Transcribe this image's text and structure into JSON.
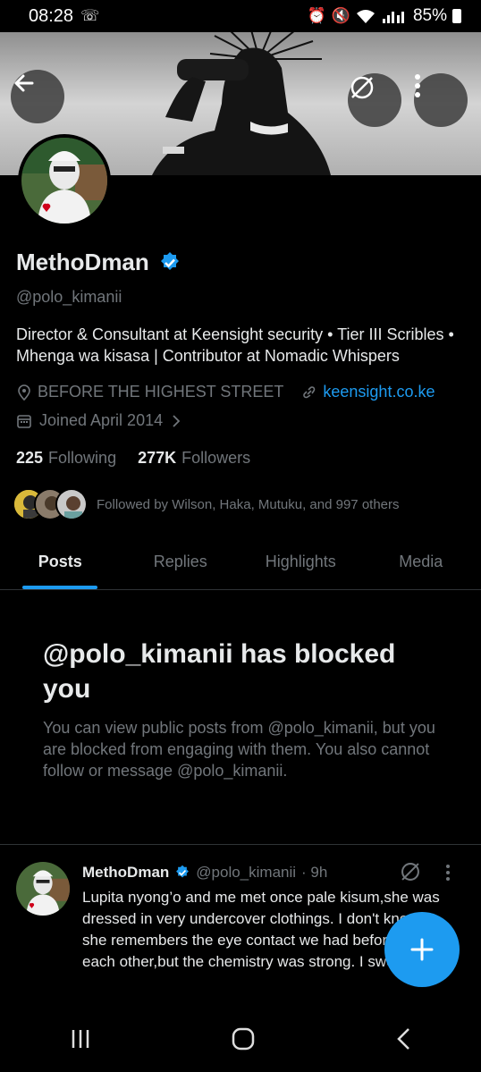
{
  "status_bar": {
    "time": "08:28",
    "battery": "85%"
  },
  "profile": {
    "display_name": "MethoDman",
    "handle": "@polo_kimanii",
    "bio_line1": "Director & Consultant at Keensight security • Tier III Scribles •",
    "bio_line2": "Mhenga wa kisasa | Contributor at Nomadic Whispers",
    "location": "BEFORE THE HIGHEST STREET",
    "website": "keensight.co.ke",
    "joined": "Joined April 2014",
    "following_count": "225",
    "following_label": "Following",
    "followers_count": "277K",
    "followers_label": "Followers",
    "followed_by": "Followed by Wilson, Haka, Mutuku, and 997 others"
  },
  "tabs": [
    {
      "label": "Posts"
    },
    {
      "label": "Replies"
    },
    {
      "label": "Highlights"
    },
    {
      "label": "Media"
    }
  ],
  "blocked_notice": {
    "title": "@polo_kimanii has blocked you",
    "description": "You can view public posts from @polo_kimanii, but you are blocked from engaging with them. You also cannot follow or message @polo_kimanii."
  },
  "post": {
    "author_name": "MethoDman",
    "author_handle": "@polo_kimanii",
    "time": "· 9h",
    "text": "Lupita nyong’o and me met once pale kisum,she was dressed in very undercover clothings. I don't know if she remembers the eye contact we had before passing each other,but the chemistry was strong. I swear"
  },
  "colors": {
    "accent": "#1d9bf0",
    "secondary_text": "#71767b",
    "background": "#000000"
  }
}
